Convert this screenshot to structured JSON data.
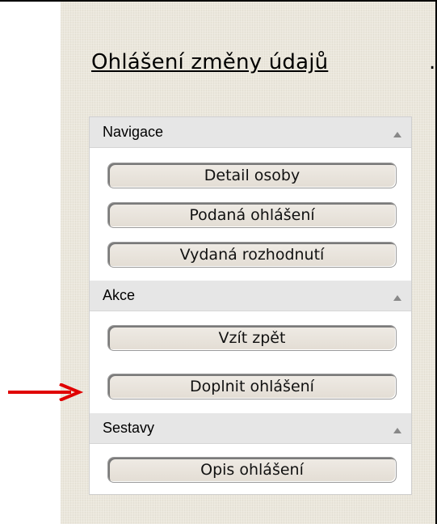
{
  "page": {
    "title": "Ohlášení změny údajů",
    "title_trail": "",
    "accent_arrow_color": "#e00000"
  },
  "menu": {
    "sections": [
      {
        "label": "Navigace",
        "items": [
          "Detail osoby",
          "Podaná ohlášení",
          "Vydaná rozhodnutí"
        ]
      },
      {
        "label": "Akce",
        "items": [
          "Vzít zpět",
          "Doplnit ohlášení"
        ]
      },
      {
        "label": "Sestavy",
        "items": [
          "Opis ohlášení"
        ]
      }
    ]
  }
}
